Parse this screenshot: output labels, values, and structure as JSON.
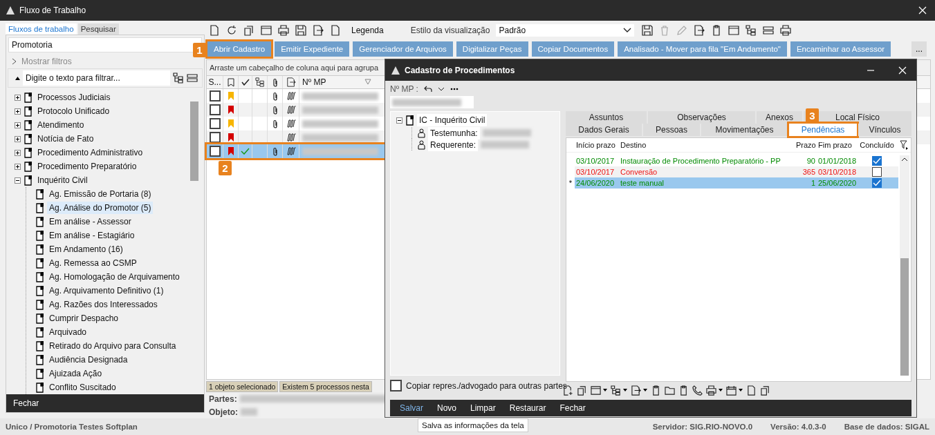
{
  "window": {
    "title": "Fluxo de Trabalho"
  },
  "left_panel": {
    "tabs": [
      {
        "label": "Fluxos de trabalho",
        "selected": true
      },
      {
        "label": "Pesquisar",
        "selected": false
      }
    ],
    "dropdown": "Promotoria",
    "show_filters": "Mostrar filtros",
    "filter_placeholder": "Digite o texto para filtrar...",
    "tree": [
      {
        "label": "Processos Judiciais",
        "expanded": false,
        "selected": false
      },
      {
        "label": "Protocolo Unificado",
        "expanded": false,
        "selected": false
      },
      {
        "label": "Atendimento",
        "expanded": false,
        "selected": false
      },
      {
        "label": "Notícia de Fato",
        "expanded": false,
        "selected": false
      },
      {
        "label": "Procedimento Administrativo",
        "expanded": false,
        "selected": false
      },
      {
        "label": "Procedimento Preparatório",
        "expanded": false,
        "selected": false
      },
      {
        "label": "Inquérito Civil",
        "expanded": true,
        "selected": false,
        "children": [
          {
            "label": "Ag. Emissão de Portaria (8)",
            "selected": false
          },
          {
            "label": "Ag. Análise do Promotor (5)",
            "selected": true
          },
          {
            "label": "Em análise - Assessor",
            "selected": false
          },
          {
            "label": "Em análise - Estagiário",
            "selected": false
          },
          {
            "label": "Em Andamento (16)",
            "selected": false
          },
          {
            "label": "Ag. Remessa ao CSMP",
            "selected": false
          },
          {
            "label": "Ag. Homologação de Arquivamento",
            "selected": false
          },
          {
            "label": "Ag. Arquivamento Definitivo (1)",
            "selected": false
          },
          {
            "label": "Ag. Razões dos Interessados",
            "selected": false
          },
          {
            "label": "Cumprir Despacho",
            "selected": false
          },
          {
            "label": "Arquivado",
            "selected": false
          },
          {
            "label": "Retirado do Arquivo para Consulta",
            "selected": false
          },
          {
            "label": "Audiência Designada",
            "selected": false
          },
          {
            "label": "Ajuizada Ação",
            "selected": false
          },
          {
            "label": "Conflito Suscitado",
            "selected": false
          }
        ]
      }
    ],
    "close_button": "Fechar"
  },
  "toolbar": {
    "legend": "Legenda",
    "view_style_label": "Estilo da visualização",
    "view_style": "Padrão"
  },
  "actions": [
    {
      "label": "Abrir Cadastro",
      "highlighted": true,
      "callout": "1"
    },
    {
      "label": "Emitir Expediente",
      "highlighted": false
    },
    {
      "label": "Gerenciador de Arquivos",
      "highlighted": false
    },
    {
      "label": "Digitalizar Peças",
      "highlighted": false
    },
    {
      "label": "Copiar Documentos",
      "highlighted": false
    },
    {
      "label": "Analisado - Mover para fila \"Em Andamento\"",
      "highlighted": false
    },
    {
      "label": "Encaminhar ao Assessor",
      "highlighted": false
    }
  ],
  "more_button": "...",
  "grid": {
    "group_hint": "Arraste um cabeçalho de coluna aqui para agrupa",
    "first_column": "S...",
    "mp_column": "Nº MP",
    "rows": [
      {
        "checked": false,
        "color": "#f7b500",
        "done": false,
        "attachment": true,
        "selected": false,
        "highlighted": false
      },
      {
        "checked": false,
        "color": "#d40000",
        "done": false,
        "attachment": true,
        "selected": false,
        "highlighted": false
      },
      {
        "checked": false,
        "color": "#f7b500",
        "done": false,
        "attachment": true,
        "selected": false,
        "highlighted": false
      },
      {
        "checked": false,
        "color": "#d40000",
        "done": false,
        "attachment": false,
        "selected": false,
        "highlighted": false
      },
      {
        "checked": false,
        "color": "#d40000",
        "done": true,
        "attachment": true,
        "selected": true,
        "highlighted": true,
        "callout": "2"
      }
    ],
    "status": [
      "1 objeto selecionado",
      "Existem 5 processos nesta"
    ],
    "details": [
      "Partes:",
      "Objeto:"
    ]
  },
  "dialog": {
    "title": "Cadastro de Procedimentos",
    "mp_label": "Nº MP :",
    "tree": {
      "label": "IC - Inquérito Civil",
      "expanded": true,
      "children": [
        "Testemunha:",
        "Requerente:"
      ]
    },
    "copy_checkbox": {
      "label": "Copiar repres./advogado para outras partes",
      "checked": false
    },
    "tabs_top": [
      {
        "label": "Assuntos",
        "selected": false
      },
      {
        "label": "Observações",
        "selected": false
      },
      {
        "label": "Anexos",
        "selected": false
      },
      {
        "label": "Local Físico",
        "selected": false
      }
    ],
    "tabs_bottom": [
      {
        "label": "Dados Gerais",
        "selected": false,
        "highlighted": false
      },
      {
        "label": "Pessoas",
        "selected": false,
        "highlighted": false
      },
      {
        "label": "Movimentações",
        "selected": false,
        "highlighted": false
      },
      {
        "label": "Pendências",
        "selected": true,
        "highlighted": true,
        "callout": "3"
      },
      {
        "label": "Vínculos",
        "selected": false,
        "highlighted": false
      }
    ],
    "columns": [
      "Início prazo",
      "Destino",
      "Prazo",
      "Fim prazo",
      "Concluído"
    ],
    "rows": [
      {
        "start": "03/10/2017",
        "destination": "Instauração de Procedimento Preparatório - PP",
        "term": "90",
        "end": "01/01/2018",
        "done": true,
        "color": "#008a00",
        "selected": false
      },
      {
        "start": "03/10/2017",
        "destination": "Conversão",
        "term": "365",
        "end": "03/10/2018",
        "done": false,
        "color": "#ee1111",
        "selected": false
      },
      {
        "marker": "*",
        "start": "24/06/2020",
        "destination": "teste manual",
        "term": "1",
        "end": "25/06/2020",
        "done": true,
        "color": "#008a00",
        "selected": true
      }
    ],
    "footer": [
      {
        "label": "Salvar",
        "hovered": true
      },
      {
        "label": "Novo",
        "hovered": false
      },
      {
        "label": "Limpar",
        "hovered": false
      },
      {
        "label": "Restaurar",
        "hovered": false
      },
      {
        "label": "Fechar",
        "hovered": false
      }
    ],
    "tooltip": "Salva as informações da tela"
  },
  "status_bar": {
    "left": "Unico / Promotoria Testes Softplan",
    "server": "Servidor: SIG.RIO-NOVO.0",
    "version": "Versão: 4.0.3-0",
    "database": "Base de dados: SIGAL"
  }
}
